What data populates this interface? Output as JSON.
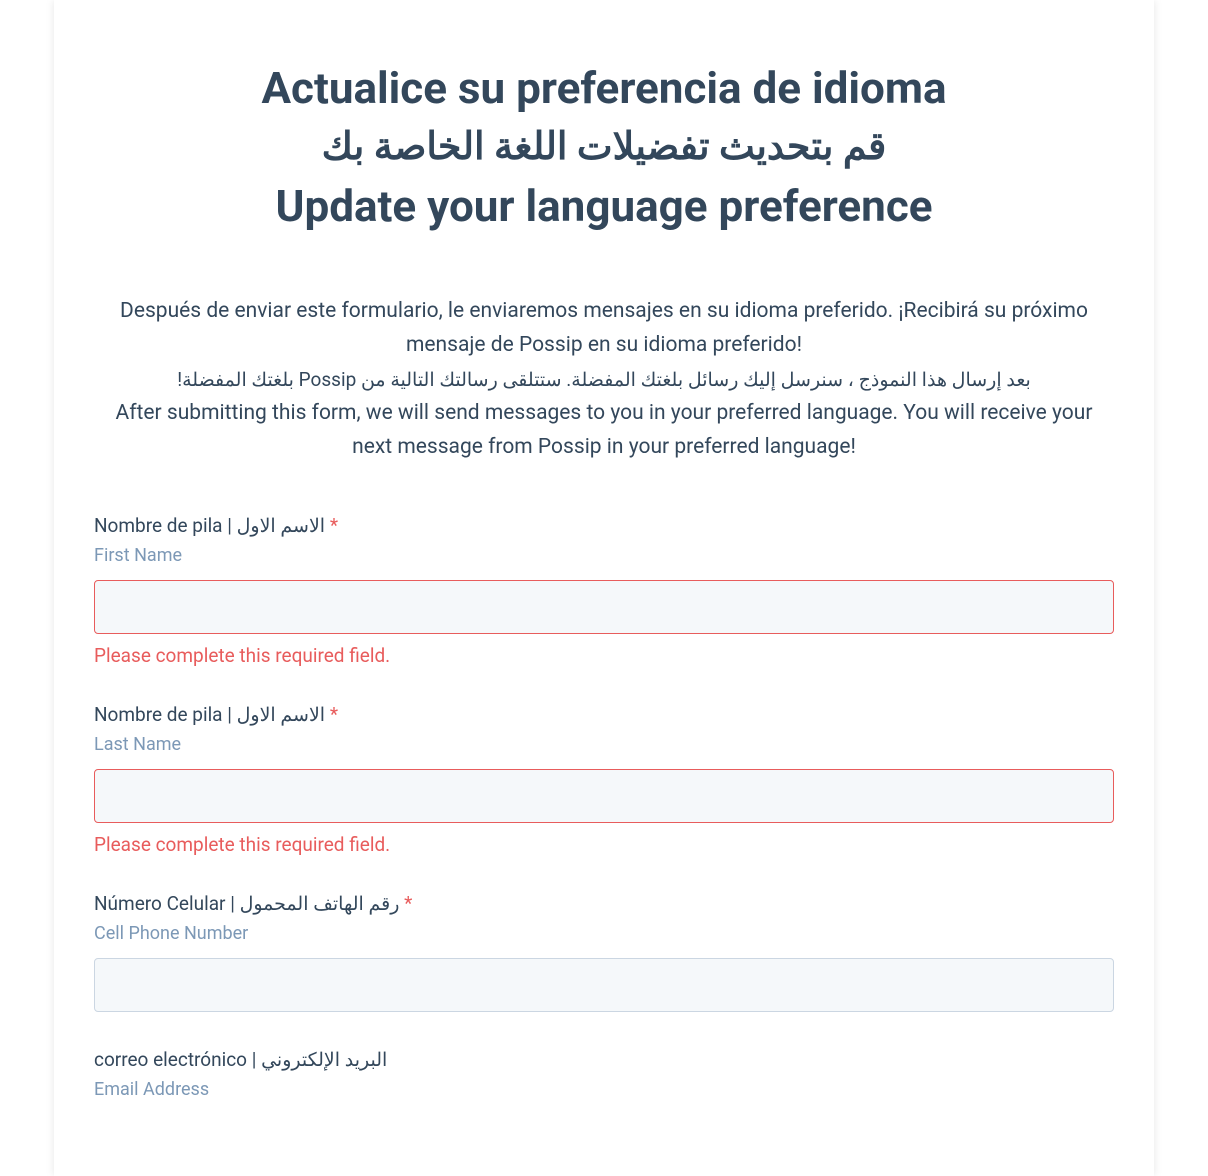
{
  "header": {
    "title_es": "Actualice su preferencia de idioma",
    "title_ar": "قم بتحديث تفضيلات اللغة الخاصة بك",
    "title_en": "Update your language preference"
  },
  "description": {
    "desc_es": "Después de enviar este formulario, le enviaremos mensajes en su idioma preferido. ¡Recibirá su próximo mensaje de Possip en su idioma preferido!",
    "desc_ar": "بعد إرسال هذا النموذج ، سنرسل إليك رسائل بلغتك المفضلة. ستتلقى رسالتك التالية من Possip بلغتك المفضلة!",
    "desc_en": "After submitting this form, we will send messages to you in your preferred language. You will receive your next message from Possip in your preferred language!"
  },
  "fields": {
    "first_name": {
      "label": "Nombre de pila | الاسم الاول",
      "required_marker": "*",
      "sublabel": "First Name",
      "value": "",
      "error": "Please complete this required field.",
      "has_error": true
    },
    "last_name": {
      "label": "Nombre de pila | الاسم الاول",
      "required_marker": "*",
      "sublabel": "Last Name",
      "value": "",
      "error": "Please complete this required field.",
      "has_error": true
    },
    "cell_phone": {
      "label": "Número Celular | رقم الهاتف المحمول",
      "required_marker": "*",
      "sublabel": "Cell Phone Number",
      "value": "",
      "has_error": false
    },
    "email": {
      "label": "correo electrónico | البريد الإلكتروني",
      "required_marker": "",
      "sublabel": "Email Address",
      "value": "",
      "has_error": false
    }
  }
}
